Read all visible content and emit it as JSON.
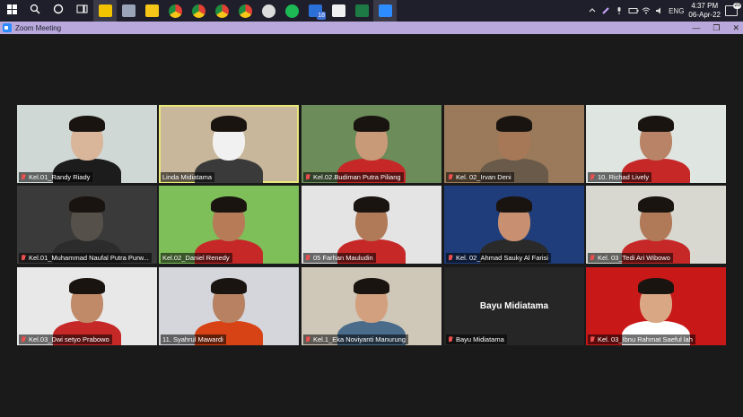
{
  "taskbar": {
    "apps": [
      {
        "name": "windows-start-icon",
        "color": "#ffffff",
        "active": false
      },
      {
        "name": "search-icon",
        "color": "#ffffff",
        "active": false
      },
      {
        "name": "cortana-icon",
        "color": "#ffffff",
        "active": false
      },
      {
        "name": "task-view-icon",
        "color": "#ffffff",
        "active": false
      },
      {
        "name": "sticky-notes-icon",
        "color": "#f2c400",
        "active": true
      },
      {
        "name": "scanner-icon",
        "color": "#9aa4b8",
        "active": false
      },
      {
        "name": "file-explorer-icon",
        "color": "#f5c518",
        "active": false
      },
      {
        "name": "chrome-icon",
        "color": "#e34133",
        "active": false
      },
      {
        "name": "chrome-icon",
        "color": "#e34133",
        "active": false
      },
      {
        "name": "chrome-icon",
        "color": "#e34133",
        "active": false
      },
      {
        "name": "chrome-icon",
        "color": "#e34133",
        "active": false
      },
      {
        "name": "obs-icon",
        "color": "#dcdcdc",
        "active": false
      },
      {
        "name": "spotify-icon",
        "color": "#1db954",
        "active": false
      },
      {
        "name": "calendar-app-icon",
        "color": "#2b6fd8",
        "active": false,
        "badge": "18"
      },
      {
        "name": "notion-icon",
        "color": "#f0f0f0",
        "active": false
      },
      {
        "name": "excel-icon",
        "color": "#1d7a45",
        "active": false
      },
      {
        "name": "zoom-icon",
        "color": "#2d8cff",
        "active": true
      }
    ],
    "tray": {
      "language": "ENG",
      "time": "4:37 PM",
      "date": "06-Apr-22",
      "notifications": "20"
    }
  },
  "window": {
    "title": "Zoom Meeting",
    "accent": "#b8a8dc"
  },
  "participants": [
    {
      "name": "Kel.01_Randy Riady",
      "muted": true,
      "speaking": false,
      "video": true,
      "bg": "#cfd8d4",
      "face": "#d9b59a",
      "shirt": "#1c1c1c"
    },
    {
      "name": "Linda Midiatama",
      "muted": false,
      "speaking": true,
      "video": true,
      "bg": "#c8b79a",
      "face": "#f1f1f1",
      "shirt": "#3a3a3a"
    },
    {
      "name": "Kel.02.Budiman Putra Piliang",
      "muted": true,
      "speaking": false,
      "video": true,
      "bg": "#6c8c5a",
      "face": "#c99a78",
      "shirt": "#c62828"
    },
    {
      "name": "Kel. 02_Irvan Deni",
      "muted": true,
      "speaking": false,
      "video": true,
      "bg": "#9a7a5a",
      "face": "#a67858",
      "shirt": "#6a5a4a"
    },
    {
      "name": "10. Richad Lively",
      "muted": true,
      "speaking": false,
      "video": true,
      "bg": "#dfe6e2",
      "face": "#b88366",
      "shirt": "#c62828"
    },
    {
      "name": "Kel.01_Muhammad Naufal Putra Purw...",
      "muted": true,
      "speaking": false,
      "video": true,
      "bg": "#3a3a3a",
      "face": "#555049",
      "shirt": "#2c2c2c"
    },
    {
      "name": "Kel.02_Daniel Renedy",
      "muted": false,
      "speaking": false,
      "video": true,
      "bg": "#7fbf5a",
      "face": "#b77b58",
      "shirt": "#c62828"
    },
    {
      "name": "05 Farhan Mauludin",
      "muted": true,
      "speaking": false,
      "video": true,
      "bg": "#e4e4e4",
      "face": "#b07a58",
      "shirt": "#c62828"
    },
    {
      "name": "Kel. 02_Ahmad Sauky Al Farisi",
      "muted": true,
      "speaking": false,
      "video": true,
      "bg": "#1e3d7a",
      "face": "#c89070",
      "shirt": "#2a2a2a"
    },
    {
      "name": "Kel. 03_Tedi Ari Wibowo",
      "muted": true,
      "speaking": false,
      "video": true,
      "bg": "#d8d8d0",
      "face": "#b07a58",
      "shirt": "#c62828"
    },
    {
      "name": "Kel.03_Dwi setyo Prabowo",
      "muted": true,
      "speaking": false,
      "video": true,
      "bg": "#e8e8e8",
      "face": "#c08a68",
      "shirt": "#c62828"
    },
    {
      "name": "11. Syahrul Mawardi",
      "muted": false,
      "speaking": false,
      "video": true,
      "bg": "#d4d6dc",
      "face": "#b88262",
      "shirt": "#d84315"
    },
    {
      "name": "Kel.1_Eka Noviyanti Manurung",
      "muted": true,
      "speaking": false,
      "video": true,
      "bg": "#cfc7b8",
      "face": "#d2a07e",
      "shirt": "#4a6b8a"
    },
    {
      "name": "Bayu Midiatama",
      "muted": true,
      "speaking": false,
      "video": false,
      "bg": "#262626",
      "face": "",
      "shirt": ""
    },
    {
      "name": "Kel. 03_Ibnu Rahmat Saeful lah",
      "muted": true,
      "speaking": false,
      "video": true,
      "bg": "#c81818",
      "face": "#d9a784",
      "shirt": "#ffffff"
    }
  ]
}
